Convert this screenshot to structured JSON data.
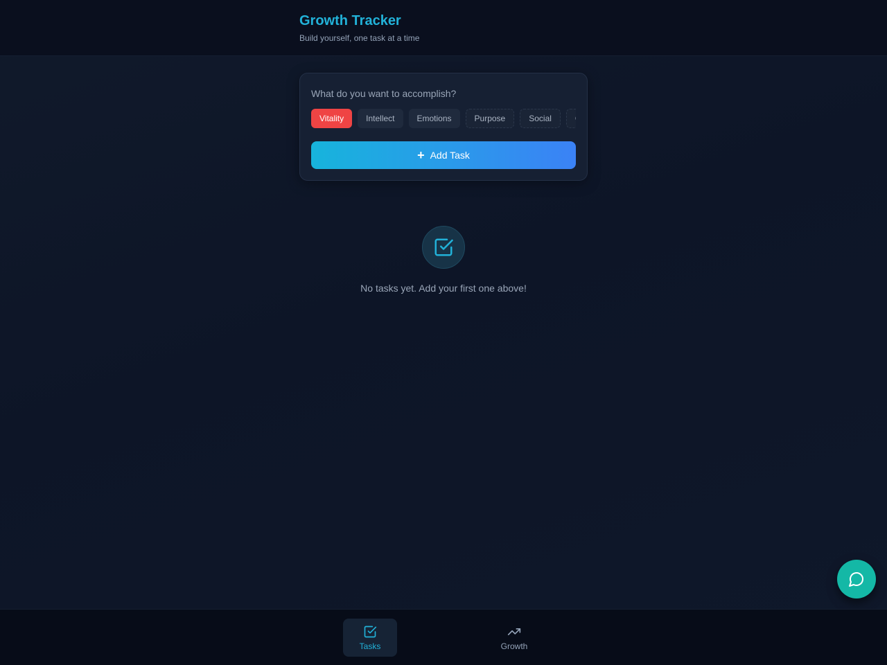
{
  "header": {
    "title": "Growth Tracker",
    "subtitle": "Build yourself, one task at a time"
  },
  "task_form": {
    "placeholder": "What do you want to accomplish?",
    "categories": [
      {
        "label": "Vitality",
        "active": true
      },
      {
        "label": "Intellect",
        "active": false
      },
      {
        "label": "Emotions",
        "active": false
      },
      {
        "label": "Purpose",
        "active": false
      },
      {
        "label": "Social",
        "active": false
      },
      {
        "label": "G",
        "active": false
      }
    ],
    "add_button_label": "Add Task",
    "add_button_icon": "plus-icon"
  },
  "empty_state": {
    "icon": "checkbox-icon",
    "message": "No tasks yet. Add your first one above!"
  },
  "chat_fab": {
    "icon": "chat-bubble-icon"
  },
  "bottom_nav": {
    "items": [
      {
        "label": "Tasks",
        "icon": "checkbox-icon",
        "active": true
      },
      {
        "label": "Growth",
        "icon": "trending-up-icon",
        "active": false
      }
    ]
  },
  "colors": {
    "accent": "#22b2d9",
    "active_chip": "#ef4444",
    "button_gradient_start": "#17b4dc",
    "button_gradient_end": "#3b82f6",
    "fab": "#14b8a6"
  }
}
